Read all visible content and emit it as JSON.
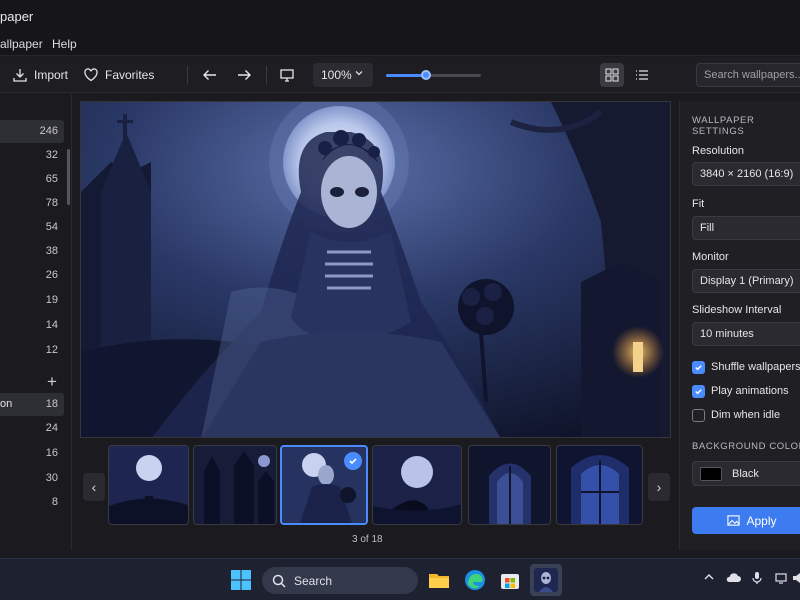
{
  "window": {
    "title": "paper"
  },
  "menu": {
    "items": [
      "allpaper",
      "Help"
    ]
  },
  "toolbar": {
    "import_label": "Import",
    "favorites_label": "Favorites",
    "zoom_value": "100%",
    "zoom_slider_fraction": 0.42,
    "view_mode": "grid",
    "search_placeholder": "Search wallpapers..."
  },
  "sidebar": {
    "items": [
      {
        "label": "",
        "count": "246",
        "active": true
      },
      {
        "label": "",
        "count": "32"
      },
      {
        "label": "",
        "count": "65"
      },
      {
        "label": "",
        "count": "78"
      },
      {
        "label": "",
        "count": "54"
      },
      {
        "label": "",
        "count": "38"
      },
      {
        "label": "",
        "count": "26"
      },
      {
        "label": "",
        "count": "19"
      },
      {
        "label": "",
        "count": "14"
      },
      {
        "label": "",
        "count": "12"
      }
    ],
    "albums": [
      {
        "label": "on",
        "count": "18",
        "active": true
      },
      {
        "label": "",
        "count": "24"
      },
      {
        "label": "",
        "count": "16"
      },
      {
        "label": "",
        "count": "30"
      },
      {
        "label": "",
        "count": "8"
      }
    ]
  },
  "gallery": {
    "page_indicator": "3 of 18",
    "selected_index": 2,
    "thumbnail_count": 6
  },
  "settings": {
    "header": "WALLPAPER SETTINGS",
    "resolution_label": "Resolution",
    "resolution_value": "3840 × 2160 (16:9)",
    "fit_label": "Fit",
    "fit_value": "Fill",
    "monitor_label": "Monitor",
    "monitor_value": "Display 1 (Primary)",
    "slideshow_label": "Slideshow Interval",
    "slideshow_value": "10 minutes",
    "shuffle_label": "Shuffle wallpapers",
    "shuffle_checked": true,
    "animations_label": "Play animations",
    "animations_checked": true,
    "dim_label": "Dim when idle",
    "dim_checked": false,
    "bg_header": "BACKGROUND COLOR",
    "bg_color_label": "Black",
    "bg_color": "#000000",
    "apply_label": "Apply"
  },
  "taskbar": {
    "search_label": "Search"
  },
  "colors": {
    "accent": "#4a8cff",
    "apply": "#3d7bf0"
  }
}
